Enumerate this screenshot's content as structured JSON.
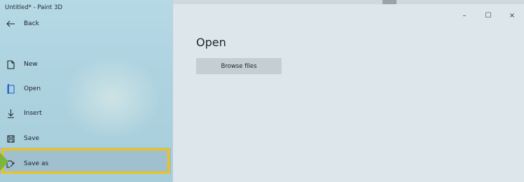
{
  "window": {
    "title": "Untitled* - Paint 3D",
    "controls": {
      "minimize": "–",
      "maximize": "☐",
      "close": "×"
    }
  },
  "sidebar": {
    "back_label": "Back",
    "items": [
      {
        "label": "New",
        "icon": "new-file-icon"
      },
      {
        "label": "Open",
        "icon": "open-folder-icon"
      },
      {
        "label": "Insert",
        "icon": "insert-arrow-icon"
      },
      {
        "label": "Save",
        "icon": "save-disk-icon"
      },
      {
        "label": "Save as",
        "icon": "save-as-icon"
      }
    ]
  },
  "main": {
    "title": "Open",
    "browse_button": "Browse files"
  },
  "colors": {
    "sidebar_bg": "#aed3e0",
    "main_bg": "#dde6eb",
    "active_indicator": "#2a68c8",
    "highlight_border": "#f4c20d",
    "pointer_arrow": "#7cb63b"
  }
}
